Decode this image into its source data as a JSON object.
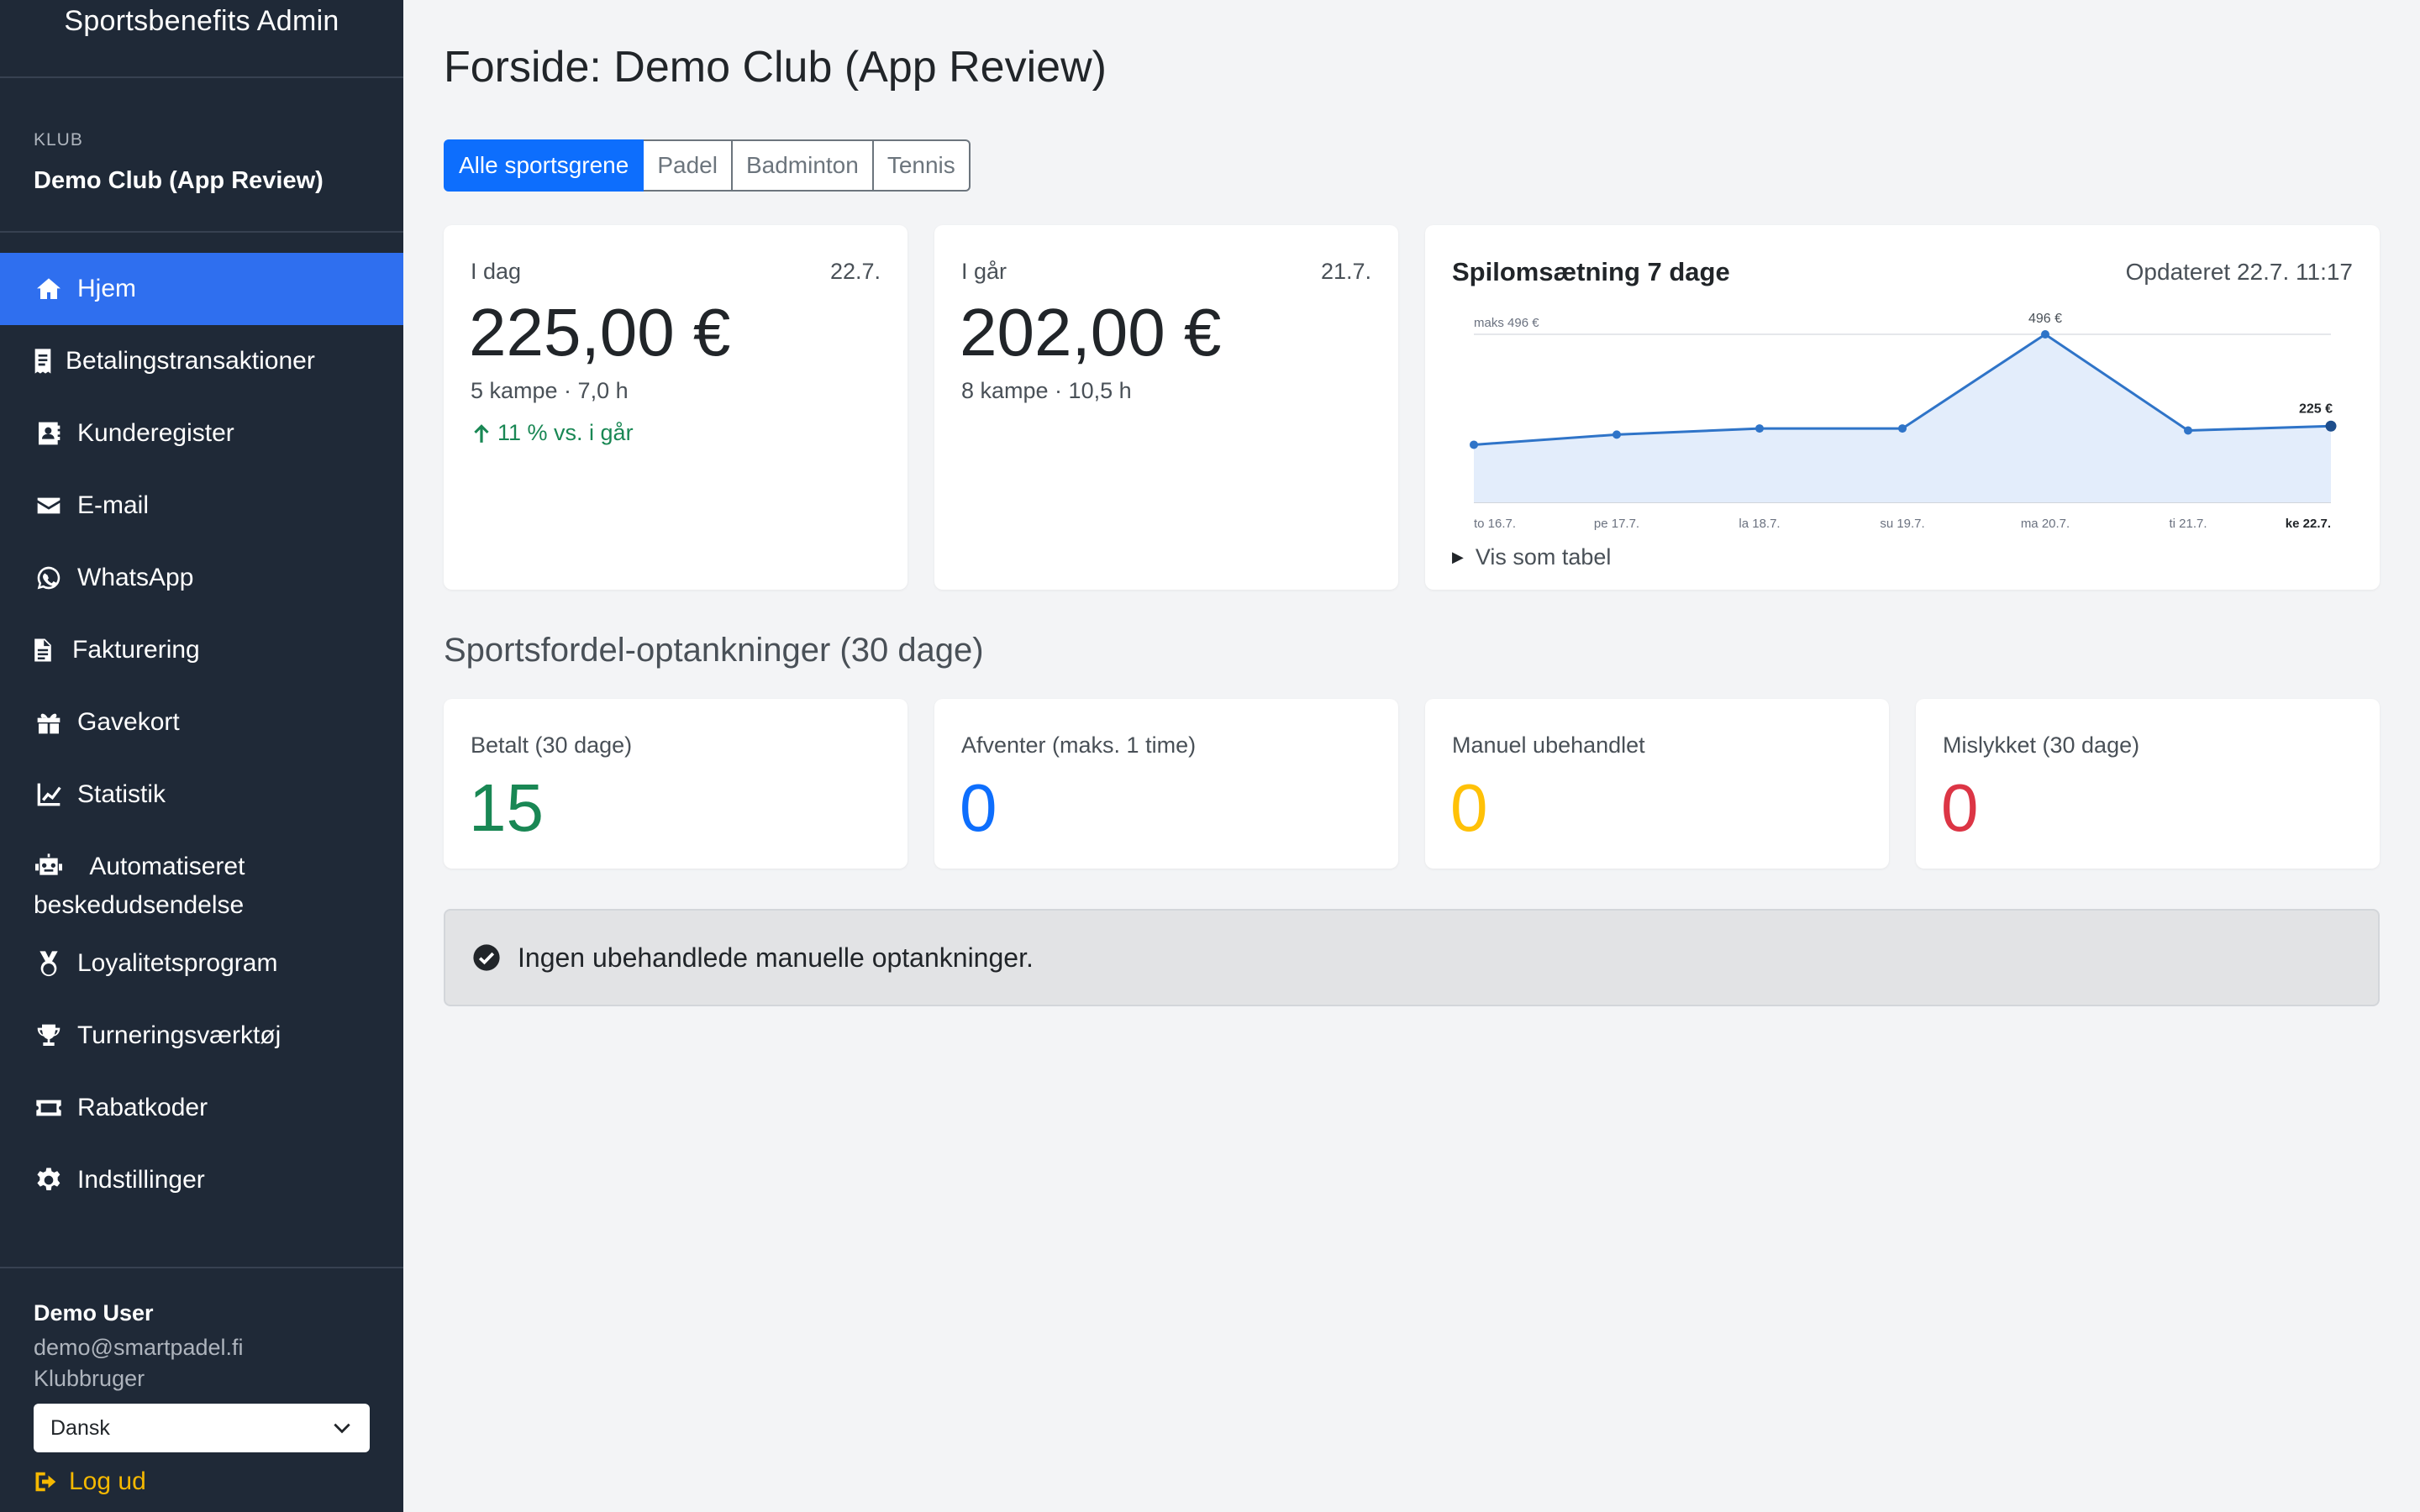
{
  "app": {
    "brand": "Sportsbenefits Admin"
  },
  "club": {
    "label": "KLUB",
    "name": "Demo Club (App Review)"
  },
  "nav": [
    {
      "label": "Hjem",
      "icon": "home-icon"
    },
    {
      "label": "Betalingstransaktioner",
      "icon": "receipt-icon"
    },
    {
      "label": "Kunderegister",
      "icon": "contact-card-icon"
    },
    {
      "label": "E-mail",
      "icon": "envelope-icon"
    },
    {
      "label": "WhatsApp",
      "icon": "whatsapp-icon"
    },
    {
      "label": "Fakturering",
      "icon": "invoice-icon"
    },
    {
      "label": "Gavekort",
      "icon": "gift-icon"
    },
    {
      "label": "Statistik",
      "icon": "chart-line-icon"
    },
    {
      "label": "Automatiseret beskedudsendelse",
      "icon": "robot-icon"
    },
    {
      "label": "Loyalitetsprogram",
      "icon": "medal-icon"
    },
    {
      "label": "Turneringsværktøj",
      "icon": "trophy-icon"
    },
    {
      "label": "Rabatkoder",
      "icon": "ticket-icon"
    },
    {
      "label": "Indstillinger",
      "icon": "gear-icon"
    }
  ],
  "user": {
    "name": "Demo User",
    "email": "demo@smartpadel.fi",
    "role": "Klubbruger",
    "language": "Dansk",
    "logout": "Log ud"
  },
  "page": {
    "title": "Forside: Demo Club (App Review)"
  },
  "tabs": [
    "Alle sportsgrene",
    "Padel",
    "Badminton",
    "Tennis"
  ],
  "today": {
    "label": "I dag",
    "date": "22.7.",
    "value": "225,00 €",
    "sub": "5 kampe · 7,0 h",
    "trend": "11 % vs. i går"
  },
  "yesterday": {
    "label": "I går",
    "date": "21.7.",
    "value": "202,00 €",
    "sub": "8 kampe · 10,5 h"
  },
  "chart": {
    "title": "Spilomsætning 7 dage",
    "updated": "Opdateret 22.7. 11:17",
    "show_table": "Vis som tabel"
  },
  "chart_data": {
    "type": "area",
    "title": "Spilomsætning 7 dage",
    "categories": [
      "to 16.7.",
      "pe 17.7.",
      "la 18.7.",
      "su 19.7.",
      "ma 20.7.",
      "ti 21.7.",
      "ke 22.7."
    ],
    "values": [
      170,
      200,
      218,
      218,
      496,
      212,
      225
    ],
    "max_label": "maks 496 €",
    "peak_label": "496 €",
    "last_label": "225 €",
    "ylim": [
      0,
      496
    ],
    "grid": false,
    "line_color": "#2f74c8",
    "fill_color": "#e3edfb"
  },
  "section": {
    "title": "Sportsfordel-optankninger (30 dage)"
  },
  "stats": [
    {
      "label": "Betalt (30 dage)",
      "value": "15",
      "color": "#198754"
    },
    {
      "label": "Afventer (maks. 1 time)",
      "value": "0",
      "color": "#0d6efd"
    },
    {
      "label": "Manuel ubehandlet",
      "value": "0",
      "color": "#ffc107"
    },
    {
      "label": "Mislykket (30 dage)",
      "value": "0",
      "color": "#dc3545"
    }
  ],
  "alert": {
    "text": "Ingen ubehandlede manuelle optankninger."
  }
}
